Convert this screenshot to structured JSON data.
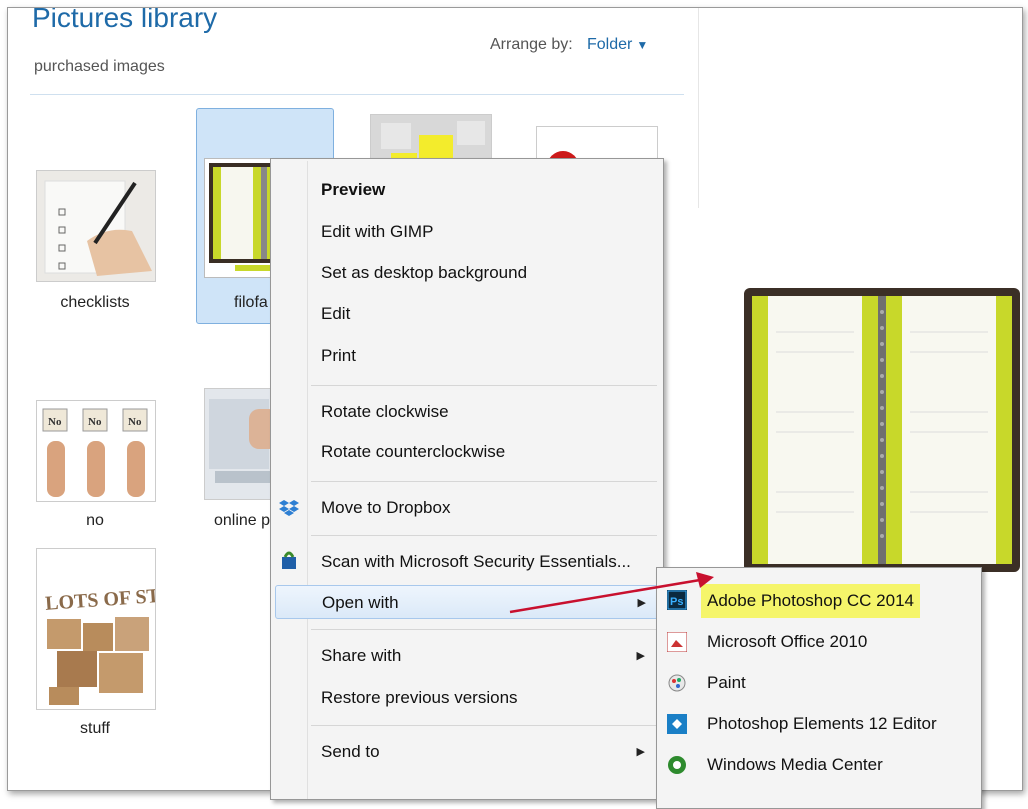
{
  "library": {
    "title": "Pictures library",
    "subtitle": "purchased images",
    "arrange_label": "Arrange by:",
    "arrange_value": "Folder"
  },
  "files": [
    {
      "label": "checklists",
      "icon": "checklist-thumbnail"
    },
    {
      "label": "filofa",
      "icon": "filofax-thumbnail",
      "selected": true
    },
    {
      "label": "no",
      "icon": "no-signs-thumbnail"
    },
    {
      "label": "online pl",
      "icon": "online-thumbnail"
    },
    {
      "label": "stuff",
      "icon": "lots-of-stuff-thumbnail"
    }
  ],
  "thumb_text": {
    "stuff": "LOTS OF STUFF",
    "no": "No"
  },
  "context_menu": {
    "items": [
      {
        "label": "Preview"
      },
      {
        "label": "Edit with GIMP"
      },
      {
        "label": "Set as desktop background"
      },
      {
        "label": "Edit"
      },
      {
        "label": "Print"
      },
      {
        "label": "Rotate clockwise"
      },
      {
        "label": "Rotate counterclockwise"
      },
      {
        "label": "Move to Dropbox",
        "icon": "dropbox-icon"
      },
      {
        "label": "Scan with Microsoft Security Essentials...",
        "icon": "security-essentials-icon"
      },
      {
        "label": "Open with",
        "submenu": true
      },
      {
        "label": "Share with",
        "submenu": true
      },
      {
        "label": "Restore previous versions"
      },
      {
        "label": "Send to",
        "submenu": true
      }
    ]
  },
  "open_with_submenu": {
    "items": [
      {
        "label": "Adobe Photoshop CC 2014",
        "icon": "photoshop-icon",
        "highlighted": true
      },
      {
        "label": "Microsoft Office 2010",
        "icon": "office-picture-manager-icon"
      },
      {
        "label": "Paint",
        "icon": "paint-icon"
      },
      {
        "label": "Photoshop Elements 12 Editor",
        "icon": "photoshop-elements-icon"
      },
      {
        "label": "Windows Media Center",
        "icon": "windows-media-center-icon"
      }
    ]
  },
  "colors": {
    "accent": "#1e6aa8",
    "selection": "#cfe4f8",
    "highlight": "#f5f56a",
    "arrow": "#c8102e",
    "filofax_green": "#c8d82a"
  }
}
